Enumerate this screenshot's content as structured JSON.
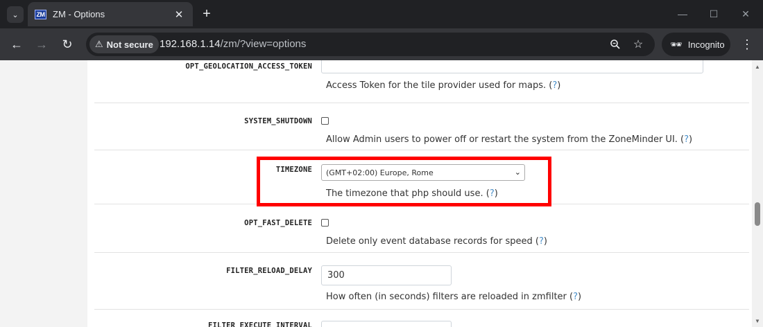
{
  "browser": {
    "tab_title": "ZM - Options",
    "favicon_text": "ZM",
    "new_tab_label": "+",
    "security_label": "Not secure",
    "url_host": "192.168.1.14",
    "url_path": "/zm/?view=options",
    "incognito_label": "Incognito"
  },
  "options": {
    "geolocation": {
      "name": "OPT_GEOLOCATION_ACCESS_TOKEN",
      "value": "",
      "description": "Access Token for the tile provider used for maps.",
      "help": "?"
    },
    "system_shutdown": {
      "name": "SYSTEM_SHUTDOWN",
      "checked": false,
      "description": "Allow Admin users to power off or restart the system from the ZoneMinder UI.",
      "help": "?"
    },
    "timezone": {
      "name": "TIMEZONE",
      "selected": "(GMT+02:00) Europe, Rome",
      "description": "The timezone that php should use.",
      "help": "?"
    },
    "fast_delete": {
      "name": "OPT_FAST_DELETE",
      "checked": false,
      "description": "Delete only event database records for speed",
      "help": "?"
    },
    "filter_reload": {
      "name": "FILTER_RELOAD_DELAY",
      "value": "300",
      "description": "How often (in seconds) filters are reloaded in zmfilter",
      "help": "?"
    },
    "filter_execute": {
      "name": "FILTER_EXECUTE_INTERVAL"
    }
  },
  "colors": {
    "highlight": "#ff0000",
    "help_link": "#4a90c9",
    "browser_frame": "#202124"
  }
}
